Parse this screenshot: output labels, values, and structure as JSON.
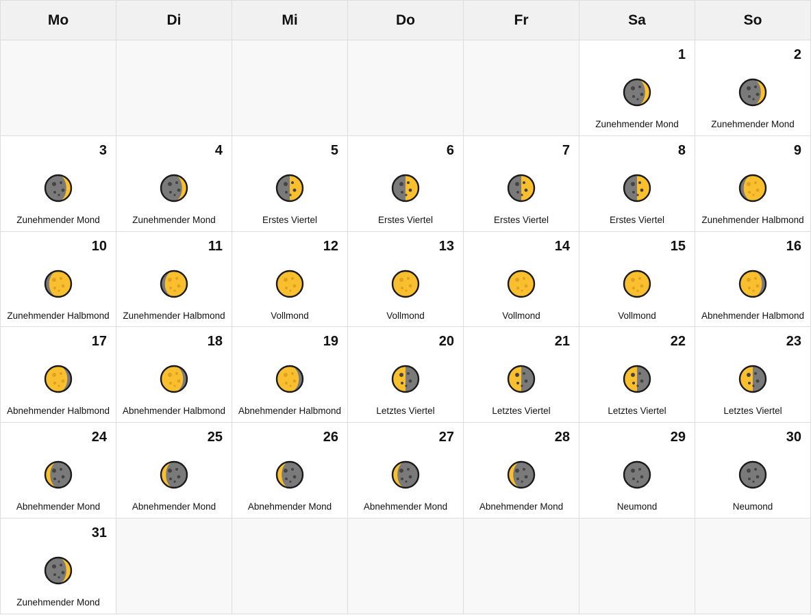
{
  "weekdays": [
    "Mo",
    "Di",
    "Mi",
    "Do",
    "Fr",
    "Sa",
    "So"
  ],
  "colors": {
    "lit": "#f9bf2e",
    "dark": "#7a7a7a",
    "outline": "#1a1a1a",
    "crater_dark": "#444444",
    "crater_lit": "#e0a020"
  },
  "leading_empty": 5,
  "trailing_empty": 6,
  "days": [
    {
      "day": "1",
      "phase": "Zunehmender Mond",
      "icon": "waxing-crescent-moon-icon"
    },
    {
      "day": "2",
      "phase": "Zunehmender Mond",
      "icon": "waxing-crescent-moon-icon"
    },
    {
      "day": "3",
      "phase": "Zunehmender Mond",
      "icon": "waxing-crescent-moon-icon"
    },
    {
      "day": "4",
      "phase": "Zunehmender Mond",
      "icon": "waxing-crescent-moon-icon"
    },
    {
      "day": "5",
      "phase": "Erstes Viertel",
      "icon": "first-quarter-moon-icon"
    },
    {
      "day": "6",
      "phase": "Erstes Viertel",
      "icon": "first-quarter-moon-icon"
    },
    {
      "day": "7",
      "phase": "Erstes Viertel",
      "icon": "first-quarter-moon-icon"
    },
    {
      "day": "8",
      "phase": "Erstes Viertel",
      "icon": "first-quarter-moon-icon"
    },
    {
      "day": "9",
      "phase": "Zunehmender Halbmond",
      "icon": "waxing-gibbous-moon-icon"
    },
    {
      "day": "10",
      "phase": "Zunehmender Halbmond",
      "icon": "waxing-gibbous-moon-icon"
    },
    {
      "day": "11",
      "phase": "Zunehmender Halbmond",
      "icon": "waxing-gibbous-moon-icon"
    },
    {
      "day": "12",
      "phase": "Vollmond",
      "icon": "full-moon-icon"
    },
    {
      "day": "13",
      "phase": "Vollmond",
      "icon": "full-moon-icon"
    },
    {
      "day": "14",
      "phase": "Vollmond",
      "icon": "full-moon-icon"
    },
    {
      "day": "15",
      "phase": "Vollmond",
      "icon": "full-moon-icon"
    },
    {
      "day": "16",
      "phase": "Abnehmender Halbmond",
      "icon": "waning-gibbous-moon-icon"
    },
    {
      "day": "17",
      "phase": "Abnehmender Halbmond",
      "icon": "waning-gibbous-moon-icon"
    },
    {
      "day": "18",
      "phase": "Abnehmender Halbmond",
      "icon": "waning-gibbous-moon-icon"
    },
    {
      "day": "19",
      "phase": "Abnehmender Halbmond",
      "icon": "waning-gibbous-moon-icon"
    },
    {
      "day": "20",
      "phase": "Letztes Viertel",
      "icon": "last-quarter-moon-icon"
    },
    {
      "day": "21",
      "phase": "Letztes Viertel",
      "icon": "last-quarter-moon-icon"
    },
    {
      "day": "22",
      "phase": "Letztes Viertel",
      "icon": "last-quarter-moon-icon"
    },
    {
      "day": "23",
      "phase": "Letztes Viertel",
      "icon": "last-quarter-moon-icon"
    },
    {
      "day": "24",
      "phase": "Abnehmender Mond",
      "icon": "waning-crescent-moon-icon"
    },
    {
      "day": "25",
      "phase": "Abnehmender Mond",
      "icon": "waning-crescent-moon-icon"
    },
    {
      "day": "26",
      "phase": "Abnehmender Mond",
      "icon": "waning-crescent-moon-icon"
    },
    {
      "day": "27",
      "phase": "Abnehmender Mond",
      "icon": "waning-crescent-moon-icon"
    },
    {
      "day": "28",
      "phase": "Abnehmender Mond",
      "icon": "waning-crescent-moon-icon"
    },
    {
      "day": "29",
      "phase": "Neumond",
      "icon": "new-moon-icon"
    },
    {
      "day": "30",
      "phase": "Neumond",
      "icon": "new-moon-icon"
    },
    {
      "day": "31",
      "phase": "Zunehmender Mond",
      "icon": "waxing-crescent-moon-icon"
    }
  ]
}
